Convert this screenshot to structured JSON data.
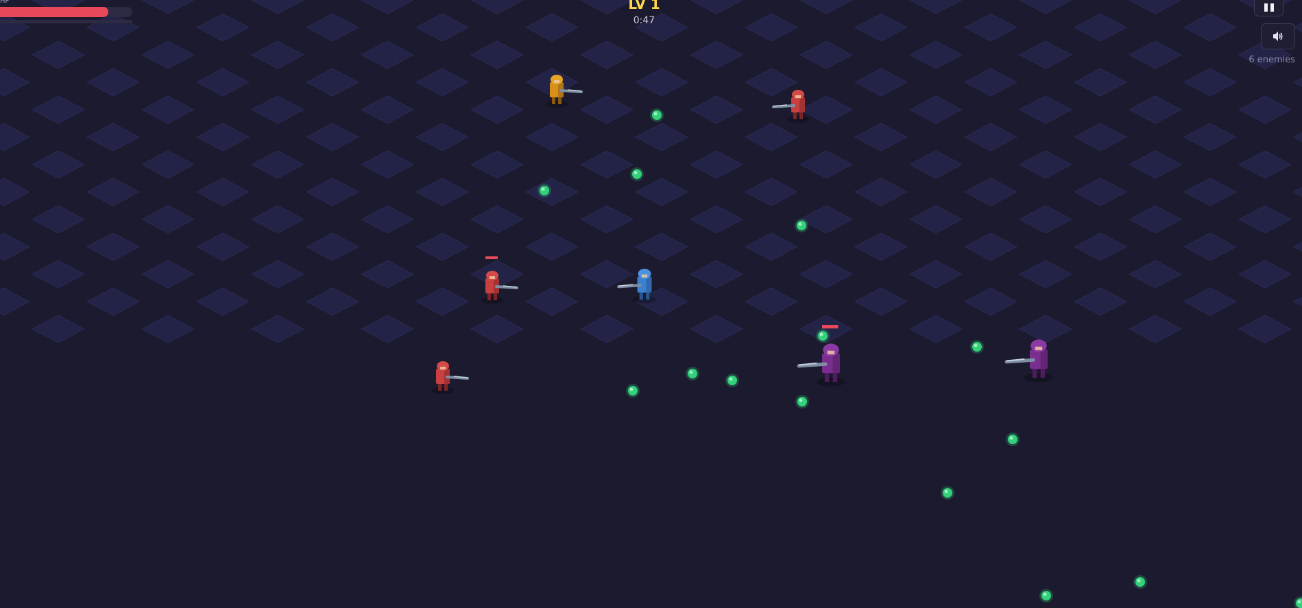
{
  "hud": {
    "hp_label": "HP",
    "hp_fraction": 0.82,
    "xp_fraction": 0.0,
    "level": "LV 1",
    "timer": "0:47",
    "enemy_count": "6 enemies",
    "pause_icon": "pause-icon",
    "sound_icon": "speaker-icon"
  },
  "colors": {
    "background": "#1b1a2e",
    "tile": "#222347",
    "hp": "#e9485a",
    "level": "#ffd84a",
    "xp_orb": "#34d07b",
    "player": "#3b7fd0",
    "enemy_red": "#c8403f",
    "enemy_purple": "#7a2e8f",
    "enemy_gold": "#d9901a"
  },
  "player": {
    "type": "player",
    "color": "blue"
  },
  "enemies": [
    {
      "type": "enemy",
      "variant": "gold"
    },
    {
      "type": "enemy",
      "variant": "red"
    },
    {
      "type": "enemy",
      "variant": "red",
      "damaged": true
    },
    {
      "type": "enemy",
      "variant": "red"
    },
    {
      "type": "enemy",
      "variant": "purple",
      "damaged": true
    },
    {
      "type": "enemy",
      "variant": "purple"
    }
  ],
  "xp_orb_count": 15
}
